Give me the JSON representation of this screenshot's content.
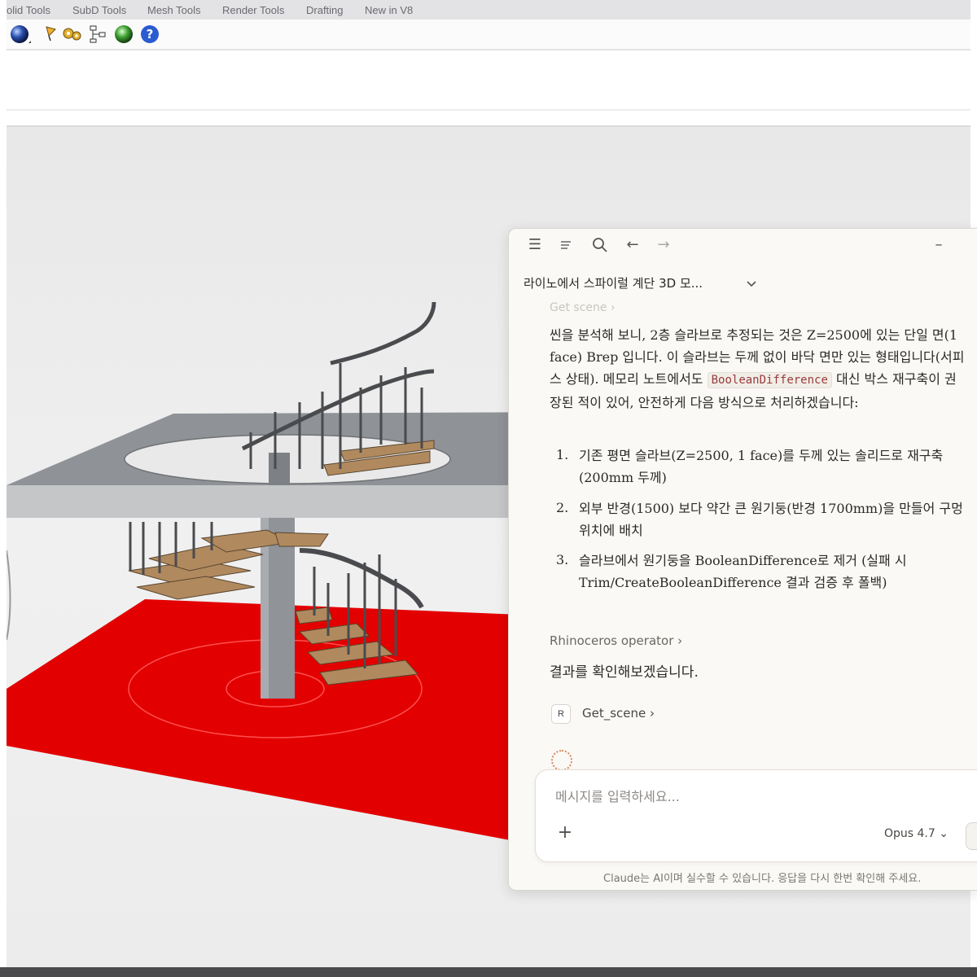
{
  "toolbar": {
    "tabs": [
      "olid Tools",
      "SubD Tools",
      "Mesh Tools",
      "Render Tools",
      "Drafting",
      "New in V8"
    ],
    "icons": [
      "sphere-render-icon",
      "flag-icon",
      "gears-icon",
      "flowchart-icon",
      "globe-icon",
      "help-icon"
    ]
  },
  "chat": {
    "title": "라이노에서 스파이럴 계단 3D 모...",
    "faded_tool": "Get scene",
    "para1": "씬을 분석해 보니, 2층 슬라브로 추정되는 것은 Z=2500에 있는 단일 면(1 face) Brep 입니다. 이 슬라브는 두께 없이 바닥 면만 있는 형태입니다(서피스 상태). 메모리 노트에서도",
    "code": "BooleanDifference",
    "para1_tail": " 대신 박스 재구축이 권장된 적이 있어, 안전하게 다음 방식으로 처리하겠습니다:",
    "steps": [
      {
        "num": "1.",
        "text": "기존 평면 슬라브(Z=2500, 1 face)를 두께 있는 솔리드로 재구축 (200mm 두께)"
      },
      {
        "num": "2.",
        "text": "외부 반경(1500) 보다 약간 큰 원기둥(반경 1700mm)을 만들어 구멍 위치에 배치"
      },
      {
        "num": "3.",
        "text": "슬라브에서 원기둥을 BooleanDifference로 제거 (실패 시 Trim/CreateBooleanDifference 결과 검증 후 폴백)"
      }
    ],
    "operator": "Rhinoceros operator",
    "result": "결과를 확인해보겠습니다.",
    "tool_badge": "R",
    "tool_name": "Get_scene",
    "placeholder": "메시지를 입력하세요...",
    "model": "Opus 4.7",
    "disclaimer": "Claude는 AI이며 실수할 수 있습니다. 응답을 다시 한번 확인해 주세요.",
    "toolbar_icons": [
      "menu-icon",
      "sidebar-icon",
      "search-icon",
      "back-arrow-icon",
      "forward-arrow-icon",
      "minimize-icon"
    ]
  },
  "colors": {
    "floor_red": "#e30000",
    "slab_gray": "#8f9296",
    "wood": "#b08a5e",
    "accent_spinner": "#d98a5f"
  }
}
